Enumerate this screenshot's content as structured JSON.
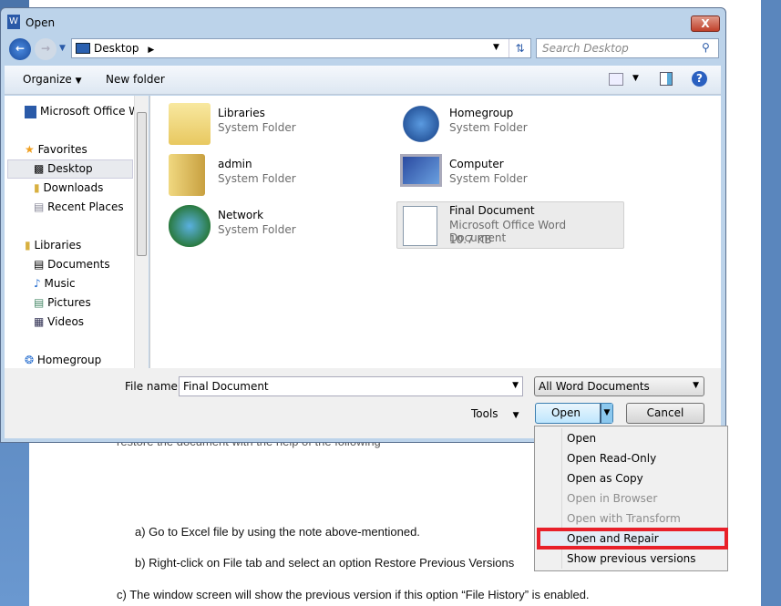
{
  "document": {
    "line_partial": "restore the document with the help of the following",
    "step_a": "a) Go to Excel file by using the note above-mentioned.",
    "step_b": "b) Right-click on File tab and select an option Restore Previous Versions",
    "step_c": "c) The window screen will show the previous version if this option “File History” is enabled."
  },
  "dialog": {
    "title": "Open",
    "close": "X",
    "address": "Desktop",
    "search_placeholder": "Search Desktop",
    "toolbar": {
      "organize": "Organize",
      "new_folder": "New folder"
    },
    "nav": {
      "pinned": "Microsoft Office W",
      "favorites": "Favorites",
      "fav_items": [
        "Desktop",
        "Downloads",
        "Recent Places"
      ],
      "libraries": "Libraries",
      "lib_items": [
        "Documents",
        "Music",
        "Pictures",
        "Videos"
      ],
      "homegroup": "Homegroup"
    },
    "items": [
      {
        "name": "Libraries",
        "type": "System Folder"
      },
      {
        "name": "Homegroup",
        "type": "System Folder"
      },
      {
        "name": "admin",
        "type": "System Folder"
      },
      {
        "name": "Computer",
        "type": "System Folder"
      },
      {
        "name": "Network",
        "type": "System Folder"
      },
      {
        "name": "Final Document",
        "type": "Microsoft Office Word Document",
        "size": "10.7 KB"
      }
    ],
    "file_name_label": "File name:",
    "file_name_value": "Final Document",
    "file_type": "All Word Documents",
    "tools": "Tools",
    "open": "Open",
    "cancel": "Cancel"
  },
  "open_menu": {
    "items": [
      "Open",
      "Open Read-Only",
      "Open as Copy",
      "Open in Browser",
      "Open with Transform",
      "Open and Repair",
      "Show previous versions"
    ],
    "disabled": [
      "Open in Browser",
      "Open with Transform"
    ],
    "highlighted": "Open and Repair",
    "highlight_color": "#e8202a"
  }
}
